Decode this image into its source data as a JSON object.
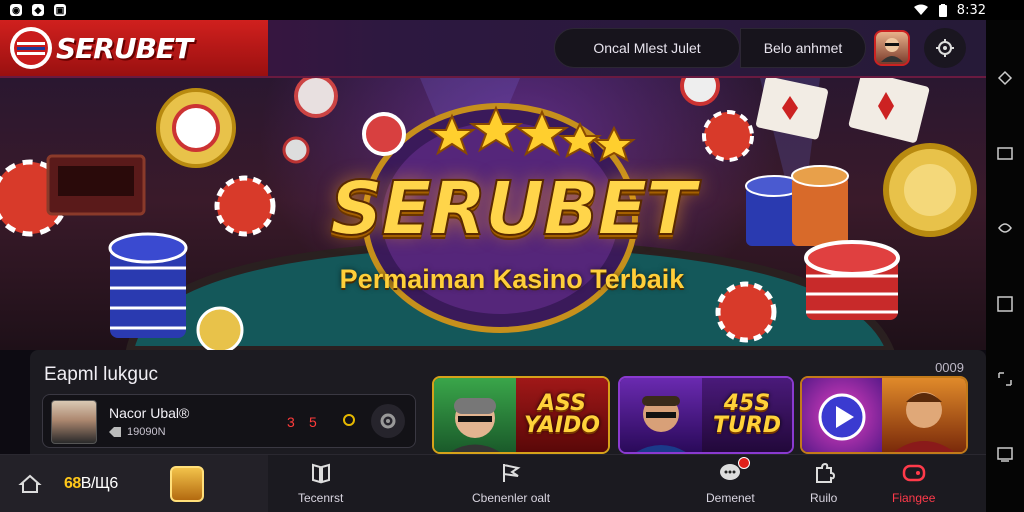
{
  "status_bar": {
    "time": "8:32"
  },
  "header": {
    "brand": "SERUBET",
    "pill_left": "Oncal Mlest Julet",
    "pill_right": "Belo anhmet",
    "avatar_icon": "user-avatar-icon",
    "settings_icon": "gear-icon"
  },
  "hero": {
    "title": "SERUBET",
    "subtitle": "Permaiman Kasino Terbaik",
    "stars": 5
  },
  "panel": {
    "title": "Eapml lukguc",
    "count": "0009",
    "user": {
      "name": "Nacor Ubal®",
      "sub": "19090N",
      "stat_a": "3",
      "stat_b": "5"
    },
    "games": [
      {
        "label": "ASS\nYAIDO",
        "accent": "#d6a21a"
      },
      {
        "label": "45S\nTURD",
        "accent": "#8a3ad0"
      },
      {
        "label": "",
        "accent": "#c27a1a"
      }
    ]
  },
  "bottom_nav": {
    "balance_prefix": "68",
    "balance_suffix": "B/Щ6",
    "items": [
      {
        "label": "Tecenrst",
        "icon": "book-icon"
      },
      {
        "label": "Cbenenler oalt",
        "icon": "flag-icon"
      },
      {
        "label": "Demenet",
        "icon": "chat-icon"
      },
      {
        "label": "Ruilo",
        "icon": "puzzle-icon"
      },
      {
        "label": "Fiangee",
        "icon": "gamepad-icon",
        "active": true
      }
    ]
  },
  "colors": {
    "brand_red": "#c91c1c",
    "gold": "#ffd54a",
    "active": "#ff3a4a"
  }
}
